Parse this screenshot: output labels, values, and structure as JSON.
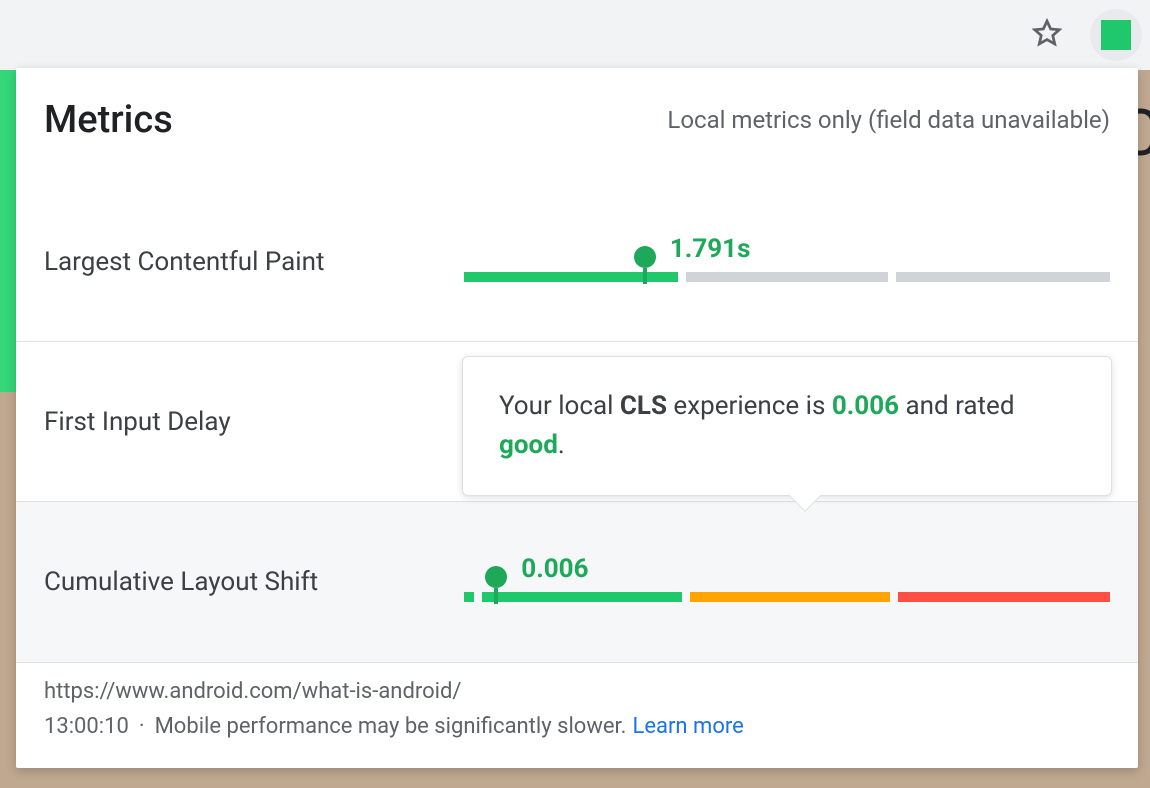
{
  "header": {
    "title": "Metrics",
    "subtitle": "Local metrics only (field data unavailable)"
  },
  "metrics": {
    "lcp": {
      "label": "Largest Contentful Paint",
      "value": "1.791s",
      "marker_percent": 28,
      "segments": [
        {
          "width_pct": 34,
          "class": "seg-good"
        },
        {
          "width_pct": 32,
          "class": "seg-gray"
        },
        {
          "width_pct": 34,
          "class": "seg-gray"
        }
      ]
    },
    "fid": {
      "label": "First Input Delay"
    },
    "cls": {
      "label": "Cumulative Layout Shift",
      "value": "0.006",
      "marker_percent": 5,
      "segments": [
        {
          "width_pct": 34,
          "class": "seg-good"
        },
        {
          "width_pct": 32,
          "class": "seg-need"
        },
        {
          "width_pct": 34,
          "class": "seg-poor"
        }
      ]
    }
  },
  "tooltip": {
    "prefix": "Your local ",
    "metric": "CLS",
    "middle": " experience is ",
    "value": "0.006",
    "middle2": " and rated ",
    "rating": "good",
    "suffix": "."
  },
  "footer": {
    "url": "https://www.android.com/what-is-android/",
    "time": "13:00:10",
    "note": "Mobile performance may be significantly slower.",
    "learn": "Learn more"
  },
  "colors": {
    "good": "#1ec86b",
    "need": "#ffa400",
    "poor": "#ff4e42"
  }
}
